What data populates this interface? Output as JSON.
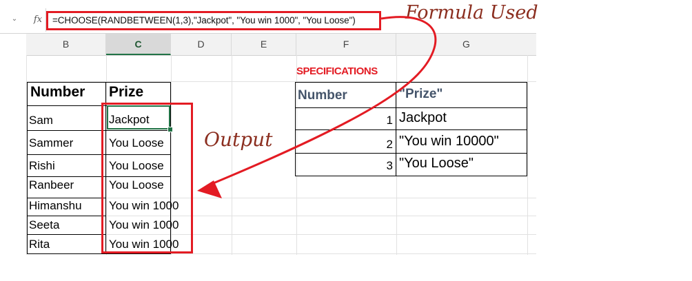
{
  "formula_bar": {
    "namebox_arrow": "⌄",
    "fx": "fx",
    "formula": "=CHOOSE(RANDBETWEEN(1,3),\"Jackpot\", \"You win 1000\", \"You Loose\")"
  },
  "columns": [
    "B",
    "C",
    "D",
    "E",
    "F",
    "G"
  ],
  "selected_column": "C",
  "annotations": {
    "formula_used": "Formula Used",
    "output": "Output",
    "accent_color": "#e31b23",
    "annotation_text_color": "#8b2e1f"
  },
  "left_table": {
    "headers": [
      "Number",
      "Prize"
    ],
    "rows": [
      [
        "Sam",
        "Jackpot"
      ],
      [
        "Sammer",
        "You Loose"
      ],
      [
        "Rishi",
        "You Loose"
      ],
      [
        "Ranbeer",
        "You Loose"
      ],
      [
        "Himanshu",
        "You win 1000"
      ],
      [
        "Seeta",
        "You win 1000"
      ],
      [
        "Rita",
        "You win 1000"
      ]
    ]
  },
  "spec_table": {
    "title": "SPECIFICATIONS",
    "headers": [
      "Number",
      "\"Prize\""
    ],
    "rows": [
      [
        "1",
        "Jackpot"
      ],
      [
        "2",
        "\"You win 10000\""
      ],
      [
        "3",
        "\"You Loose\""
      ]
    ]
  }
}
